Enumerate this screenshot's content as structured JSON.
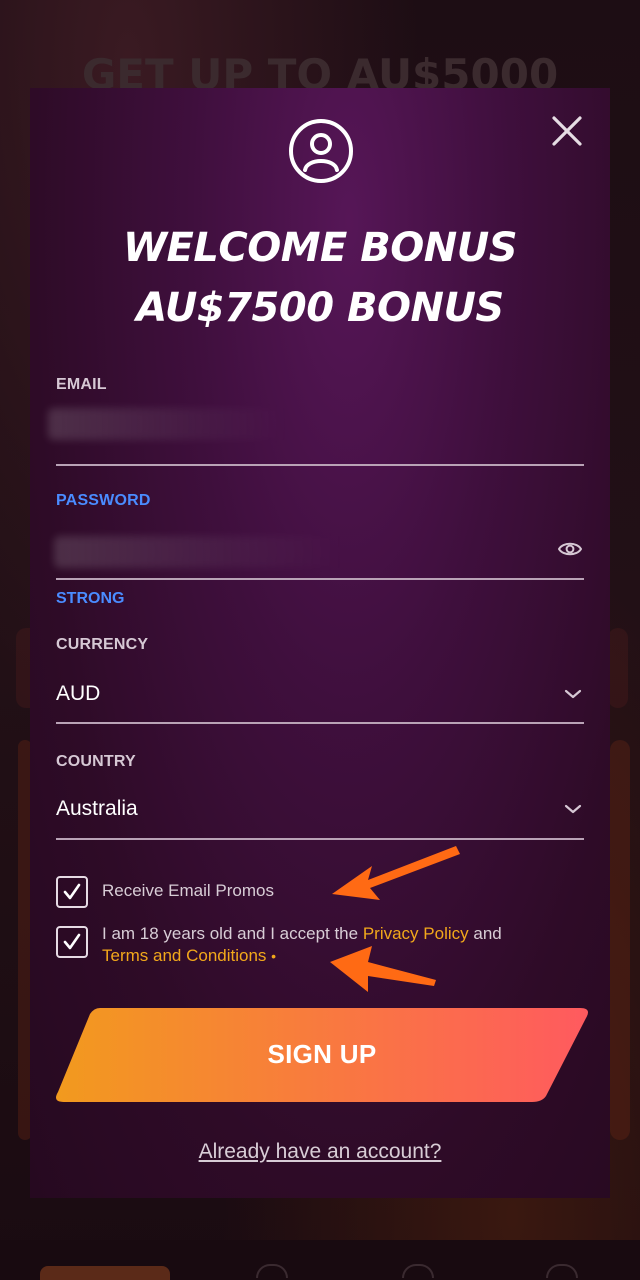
{
  "background": {
    "headline": "GET UP TO AU$5000"
  },
  "modal": {
    "title_line1": "WELCOME BONUS",
    "title_line2": "AU$7500 BONUS",
    "email": {
      "label": "EMAIL",
      "value_hidden": true
    },
    "password": {
      "label": "PASSWORD",
      "strength": "STRONG",
      "value_hidden": true
    },
    "currency": {
      "label": "CURRENCY",
      "value": "AUD"
    },
    "country": {
      "label": "COUNTRY",
      "value": "Australia"
    },
    "promos_checkbox": {
      "label": "Receive Email Promos",
      "checked": true
    },
    "terms_checkbox": {
      "text_before": "I am 18 years old and I accept the ",
      "privacy_link": "Privacy Policy",
      "text_and": " and",
      "terms_link": "Terms and Conditions",
      "required_mark": "•",
      "checked": true
    },
    "signup_label": "SIGN UP",
    "login_link": "Already have an account?"
  },
  "colors": {
    "accent_link": "#f2a81b",
    "active_label": "#4a8cff",
    "button_gradient_start": "#f29a1e",
    "button_gradient_end": "#ff5a5f",
    "annotation_arrow": "#ff6a14"
  }
}
